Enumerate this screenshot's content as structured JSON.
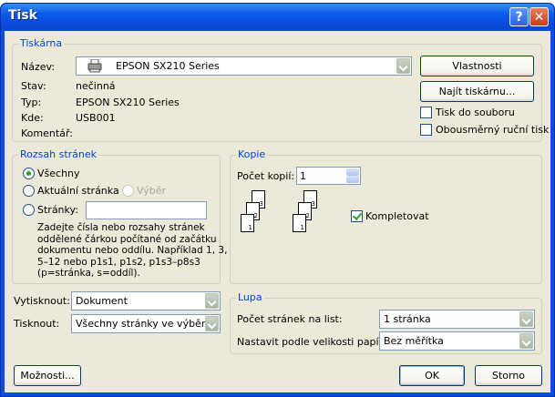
{
  "window": {
    "title": "Tisk"
  },
  "printer": {
    "legend": "Tiskárna",
    "name_label": "Název:",
    "name_value": "EPSON SX210 Series",
    "status_label": "Stav:",
    "status_value": "nečinná",
    "type_label": "Typ:",
    "type_value": "EPSON SX210 Series",
    "where_label": "Kde:",
    "where_value": "USB001",
    "comment_label": "Komentář:",
    "comment_value": "",
    "properties_button": "Vlastnosti",
    "find_button": "Najít tiskárnu...",
    "print_to_file": "Tisk do souboru",
    "duplex": "Obousměrný ruční tisk"
  },
  "range": {
    "legend": "Rozsah stránek",
    "all": "Všechny",
    "current": "Aktuální stránka",
    "selection": "Výběr",
    "pages": "Stránky:",
    "pages_value": "",
    "help": [
      "Zadejte čísla nebo rozsahy stránek",
      "oddělené čárkou počítané od začátku",
      "dokumentu nebo oddílu. Například 1, 3,",
      "5–12 nebo p1s1, p1s2, p1s3–p8s3",
      "(p=stránka, s=oddíl)."
    ]
  },
  "copies": {
    "legend": "Kopie",
    "count_label": "Počet kopií:",
    "count_value": "1",
    "collate": "Kompletovat"
  },
  "print_what": {
    "label": "Vytisknout:",
    "value": "Dokument"
  },
  "print_which": {
    "label": "Tisknout:",
    "value": "Všechny stránky ve výběru"
  },
  "zoom": {
    "legend": "Lupa",
    "pages_per_sheet_label": "Počet stránek na list:",
    "pages_per_sheet_value": "1 stránka",
    "scale_label": "Nastavit podle velikosti papíru:",
    "scale_value": "Bez měřítka"
  },
  "buttons": {
    "options": "Možnosti...",
    "ok": "OK",
    "cancel": "Storno"
  }
}
